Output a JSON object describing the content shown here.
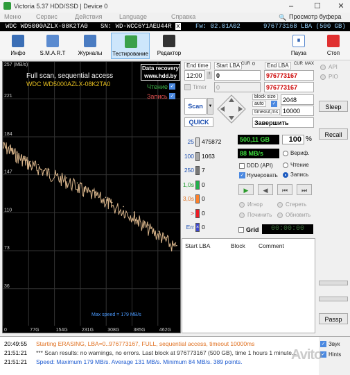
{
  "window": {
    "title": "Victoria 5.37 HDD/SSD | Device 0",
    "controls": [
      "–",
      "☐",
      "✕"
    ]
  },
  "menu": [
    "Меню",
    "Сервис",
    "Действия",
    "Language",
    "Справка",
    "Просмотр буфера"
  ],
  "info_bar": {
    "model": "WDC WD5000AZLX-08K2TA0",
    "serial": "SN: WD-WCC6Y1AEU44R",
    "close": "x",
    "firmware": "Fw: 02.01A02",
    "capacity": "976773168 LBA (500 GB)"
  },
  "toolbar": {
    "buttons": [
      {
        "label": "Инфо",
        "icon": "info-icon",
        "color": "#3b6fb6"
      },
      {
        "label": "S.M.A.R.T",
        "icon": "smart-icon",
        "color": "#5b8bd0"
      },
      {
        "label": "Журналы",
        "icon": "logs-icon",
        "color": "#4a7cc2"
      },
      {
        "label": "Тестирование",
        "icon": "testing-icon",
        "color": "#3aa04a"
      },
      {
        "label": "Редактор",
        "icon": "editor-icon",
        "color": "#333333"
      }
    ],
    "pause_label": "Пауза",
    "stop_label": "Стоп"
  },
  "graph": {
    "title": "Full scan, sequential access",
    "model": "WDC WD5000AZLX-08K2TA0",
    "data_recovery": [
      "Data recovery",
      "www.hdd.by"
    ],
    "read_label": "Чтение",
    "write_label": "Запись",
    "unit_label": "257 (MB/s)",
    "max_speed_label": "Max speed = 179 MB/s"
  },
  "chart_data": {
    "type": "line",
    "y_ticks": [
      221,
      184,
      147,
      110,
      73,
      36
    ],
    "x_ticks": [
      "0",
      "77G",
      "154G",
      "231G",
      "308G",
      "385G",
      "462G"
    ],
    "ylim": [
      0,
      257
    ],
    "x_gb": [
      0,
      20,
      40,
      60,
      77,
      100,
      130,
      154,
      180,
      210,
      231,
      260,
      290,
      308,
      340,
      370,
      385,
      410,
      440,
      462,
      490
    ],
    "speed_mbs": [
      178,
      175,
      169,
      165,
      160,
      157,
      152,
      148,
      144,
      139,
      134,
      130,
      125,
      120,
      116,
      110,
      105,
      98,
      92,
      86,
      78
    ]
  },
  "scan_params": {
    "end_time_label": "End time",
    "start_lba_label": "Start LBA",
    "cur1": "CUR",
    "cur1b": "0",
    "end_lba_label": "End LBA",
    "cur2": "CUR",
    "max_label": "MAX",
    "time_value": "12:00",
    "start_lba": "0",
    "end_lba": "976773167",
    "timer_label": "Timer",
    "timer_value": "0",
    "end_lba2": "976773167",
    "block_size_label": "block size",
    "auto_label": "auto",
    "block_size": "2048",
    "timeout_label": "timeout,ms",
    "timeout": "10000",
    "scan_label": "Scan",
    "quick_label": "QUICK",
    "finish_label": "Завершить"
  },
  "api": {
    "api_label": "API",
    "pio_label": "PIO",
    "sleep_label": "Sleep",
    "recall_label": "Recall",
    "passp_label": "Passp"
  },
  "blocks": [
    {
      "ms": "25",
      "count": "475872",
      "color": "#d8d8d8"
    },
    {
      "ms": "100",
      "count": "1063",
      "color": "#a8a8a8"
    },
    {
      "ms": "250",
      "count": "7",
      "color": "#777777"
    },
    {
      "ms": "1,0s",
      "count": "0",
      "color": "#22b14c"
    },
    {
      "ms": "3,0s",
      "count": "0",
      "color": "#ff7f27"
    },
    {
      "ms": ">",
      "count": "0",
      "color": "#ed1c24"
    },
    {
      "ms": "Err",
      "count": "0",
      "color": "#3f48cc"
    }
  ],
  "progress": {
    "size": "500,11 GB",
    "percent": "100",
    "pct_sign": "%",
    "speed": "88 MB/s",
    "verify_label": "Вериф.",
    "read_label": "Чтение",
    "write_label": "Запись",
    "ddd_label": "DDD (API)",
    "numbering_label": "Нумеровать"
  },
  "actions": {
    "ignore_label": "Игнор",
    "erase_label": "Стереть",
    "remap_label": "Починить",
    "refresh_label": "Обновить",
    "grid_label": "Grid",
    "timer_display": "00:00:00"
  },
  "table": {
    "headers": [
      "Start LBA",
      "Block",
      "Comment"
    ]
  },
  "log": [
    {
      "time": "20:49:55",
      "text": "Starting ERASING, LBA=0..976773167, FULL, sequential access, timeout 10000ms",
      "color": "#e07020"
    },
    {
      "time": "21:51:21",
      "text": "*** Scan results: no warnings, no errors. Last block at 976773167 (500 GB), time 1 hours 1 minute...",
      "color": "#333333"
    },
    {
      "time": "21:51:21",
      "text": "Speed: Maximum 179 MB/s. Average 131 MB/s. Minimum 84 MB/s. 389 points.",
      "color": "#1e5bd0"
    }
  ],
  "sound": {
    "sound_label": "Звук",
    "hints_label": "Hints"
  },
  "watermark": "Avito"
}
